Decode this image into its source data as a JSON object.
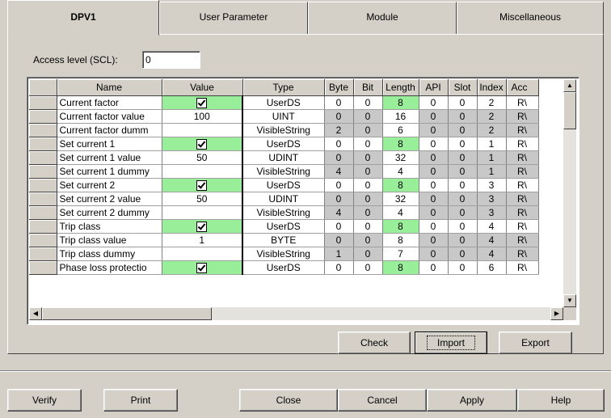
{
  "tabs": [
    "DPV1",
    "User Parameter",
    "Module",
    "Miscellaneous"
  ],
  "access_level": {
    "label": "Access level (SCL):",
    "value": "0"
  },
  "columns": [
    "Name",
    "Value",
    "Type",
    "Byte",
    "Bit",
    "Length",
    "API",
    "Slot",
    "Index",
    "Acc"
  ],
  "rows": [
    {
      "name": "Current factor",
      "value": "",
      "checked": true,
      "type": "UserDS",
      "byte": "0",
      "bit": "0",
      "length": "8",
      "api": "0",
      "slot": "0",
      "index": "2",
      "acc": "R\\"
    },
    {
      "name": "Current factor value",
      "value": "100",
      "checked": false,
      "type": "UINT",
      "byte": "0",
      "bit": "0",
      "length": "16",
      "api": "0",
      "slot": "0",
      "index": "2",
      "acc": "R\\"
    },
    {
      "name": "Current factor dumm",
      "value": "",
      "checked": false,
      "type": "VisibleString",
      "byte": "2",
      "bit": "0",
      "length": "6",
      "api": "0",
      "slot": "0",
      "index": "2",
      "acc": "R\\"
    },
    {
      "name": "Set current 1",
      "value": "",
      "checked": true,
      "type": "UserDS",
      "byte": "0",
      "bit": "0",
      "length": "8",
      "api": "0",
      "slot": "0",
      "index": "1",
      "acc": "R\\"
    },
    {
      "name": "Set current 1 value",
      "value": "50",
      "checked": false,
      "type": "UDINT",
      "byte": "0",
      "bit": "0",
      "length": "32",
      "api": "0",
      "slot": "0",
      "index": "1",
      "acc": "R\\"
    },
    {
      "name": "Set current 1 dummy",
      "value": "",
      "checked": false,
      "type": "VisibleString",
      "byte": "4",
      "bit": "0",
      "length": "4",
      "api": "0",
      "slot": "0",
      "index": "1",
      "acc": "R\\"
    },
    {
      "name": "Set current 2",
      "value": "",
      "checked": true,
      "type": "UserDS",
      "byte": "0",
      "bit": "0",
      "length": "8",
      "api": "0",
      "slot": "0",
      "index": "3",
      "acc": "R\\"
    },
    {
      "name": "Set current 2 value",
      "value": "50",
      "checked": false,
      "type": "UDINT",
      "byte": "0",
      "bit": "0",
      "length": "32",
      "api": "0",
      "slot": "0",
      "index": "3",
      "acc": "R\\"
    },
    {
      "name": "Set current 2 dummy",
      "value": "",
      "checked": false,
      "type": "VisibleString",
      "byte": "4",
      "bit": "0",
      "length": "4",
      "api": "0",
      "slot": "0",
      "index": "3",
      "acc": "R\\"
    },
    {
      "name": "Trip class",
      "value": "",
      "checked": true,
      "type": "UserDS",
      "byte": "0",
      "bit": "0",
      "length": "8",
      "api": "0",
      "slot": "0",
      "index": "4",
      "acc": "R\\"
    },
    {
      "name": "Trip class value",
      "value": "1",
      "checked": false,
      "type": "BYTE",
      "byte": "0",
      "bit": "0",
      "length": "8",
      "api": "0",
      "slot": "0",
      "index": "4",
      "acc": "R\\"
    },
    {
      "name": "Trip class dummy",
      "value": "",
      "checked": false,
      "type": "VisibleString",
      "byte": "1",
      "bit": "0",
      "length": "7",
      "api": "0",
      "slot": "0",
      "index": "4",
      "acc": "R\\"
    },
    {
      "name": "Phase loss protectio",
      "value": "",
      "checked": true,
      "type": "UserDS",
      "byte": "0",
      "bit": "0",
      "length": "8",
      "api": "0",
      "slot": "0",
      "index": "6",
      "acc": "R\\"
    }
  ],
  "grid_buttons": {
    "check": "Check",
    "import": "Import",
    "export": "Export"
  },
  "bottom_buttons": {
    "verify": "Verify",
    "print": "Print",
    "close": "Close",
    "cancel": "Cancel",
    "apply": "Apply",
    "help": "Help"
  },
  "colors": {
    "highlight": "#99ee99",
    "readonly": "#c8c8c8",
    "face": "#d4d0c8"
  }
}
